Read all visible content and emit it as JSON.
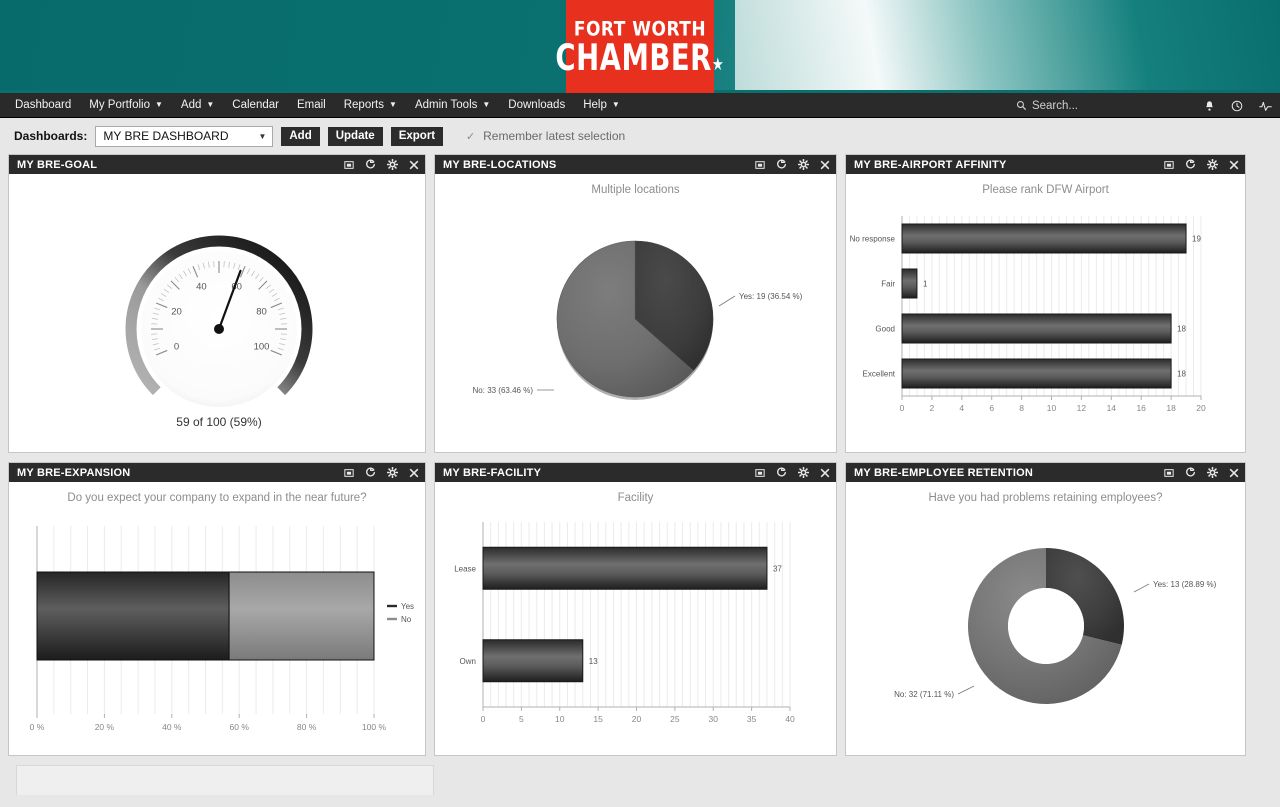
{
  "brand": {
    "logo_line1": "FORT WORTH",
    "logo_line2": "CHAMBER",
    "logo_star": "★",
    "banner_color": "#0a6e6e",
    "logo_bg": "#e8301f"
  },
  "nav": {
    "items": [
      {
        "label": "Dashboard",
        "has_caret": false
      },
      {
        "label": "My Portfolio",
        "has_caret": true
      },
      {
        "label": "Add",
        "has_caret": true
      },
      {
        "label": "Calendar",
        "has_caret": false
      },
      {
        "label": "Email",
        "has_caret": false
      },
      {
        "label": "Reports",
        "has_caret": true
      },
      {
        "label": "Admin Tools",
        "has_caret": true
      },
      {
        "label": "Downloads",
        "has_caret": false
      },
      {
        "label": "Help",
        "has_caret": true
      }
    ],
    "search_placeholder": "Search...",
    "icons": [
      "bell-icon",
      "clock-icon",
      "activity-icon"
    ]
  },
  "toolbar": {
    "label": "Dashboards:",
    "selected_dashboard": "MY BRE DASHBOARD",
    "add_label": "Add",
    "update_label": "Update",
    "export_label": "Export",
    "remember_label": "Remember latest selection",
    "remember_checked": true
  },
  "panel_icons": [
    "maximize-icon",
    "refresh-icon",
    "gear-icon",
    "close-icon"
  ],
  "panels": [
    {
      "title": "MY BRE-GOAL"
    },
    {
      "title": "MY BRE-LOCATIONS"
    },
    {
      "title": "MY BRE-AIRPORT AFFINITY"
    },
    {
      "title": "MY BRE-EXPANSION"
    },
    {
      "title": "MY BRE-FACILITY"
    },
    {
      "title": "MY BRE-EMPLOYEE RETENTION"
    }
  ],
  "chart_data": [
    {
      "type": "gauge",
      "panel": "MY BRE-GOAL",
      "title": "",
      "value": 59,
      "min": 0,
      "max": 100,
      "ticks": [
        0,
        20,
        40,
        60,
        80,
        100
      ],
      "caption": "59 of 100 (59%)"
    },
    {
      "type": "pie",
      "panel": "MY BRE-LOCATIONS",
      "title": "Multiple locations",
      "labels": [
        "Yes",
        "No"
      ],
      "values": [
        19,
        33
      ],
      "percents": [
        36.54,
        63.46
      ],
      "annotations": [
        "Yes: 19 (36.54 %)",
        "No: 33 (63.46 %)"
      ]
    },
    {
      "type": "bar",
      "orientation": "horizontal",
      "panel": "MY BRE-AIRPORT AFFINITY",
      "title": "Please rank DFW Airport",
      "categories": [
        "No response",
        "Fair",
        "Good",
        "Excellent"
      ],
      "values": [
        19,
        1,
        18,
        18
      ],
      "xlabel": "",
      "ylabel": "",
      "xlim": [
        0,
        20
      ],
      "xticks": [
        0,
        2,
        4,
        6,
        8,
        10,
        12,
        14,
        16,
        18,
        20
      ],
      "grid": true
    },
    {
      "type": "bar",
      "orientation": "horizontal-stacked-100",
      "panel": "MY BRE-EXPANSION",
      "title": "Do you expect your company to expand in the near future?",
      "series": [
        {
          "name": "Yes",
          "value": 57
        },
        {
          "name": "No",
          "value": 43
        }
      ],
      "xlim": [
        0,
        100
      ],
      "xticks": [
        "0 %",
        "20 %",
        "40 %",
        "60 %",
        "80 %",
        "100 %"
      ],
      "legend": [
        "Yes",
        "No"
      ],
      "legend_position": "right",
      "grid": true
    },
    {
      "type": "bar",
      "orientation": "horizontal",
      "panel": "MY BRE-FACILITY",
      "title": "Facility",
      "categories": [
        "Lease",
        "Own"
      ],
      "values": [
        37,
        13
      ],
      "xlim": [
        0,
        40
      ],
      "xticks": [
        0,
        5,
        10,
        15,
        20,
        25,
        30,
        35,
        40
      ],
      "grid": true
    },
    {
      "type": "pie",
      "subtype": "donut",
      "panel": "MY BRE-EMPLOYEE RETENTION",
      "title": "Have you had problems retaining employees?",
      "labels": [
        "Yes",
        "No"
      ],
      "values": [
        13,
        32
      ],
      "percents": [
        28.89,
        71.11
      ],
      "annotations": [
        "Yes: 13 (28.89 %)",
        "No: 32 (71.11 %)"
      ]
    }
  ]
}
